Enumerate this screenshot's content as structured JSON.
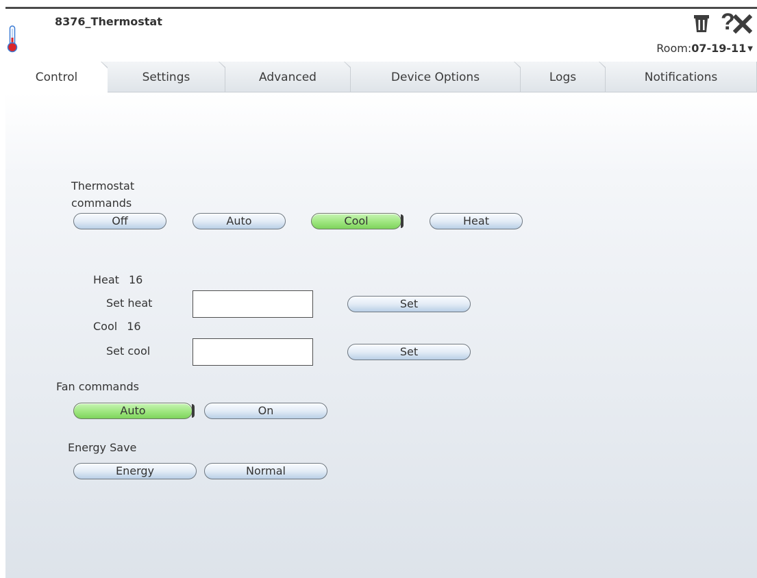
{
  "window": {
    "title": "8376_Thermostat",
    "room_label": "Room:",
    "room_value": "07-19-11",
    "device_icon": "thermometer-icon",
    "delete_icon": "trash-icon",
    "help_icon": "help-icon",
    "help_glyph": "?",
    "close_icon": "close-icon"
  },
  "tabs": [
    {
      "label": "Control",
      "active": true
    },
    {
      "label": "Settings",
      "active": false
    },
    {
      "label": "Advanced",
      "active": false
    },
    {
      "label": "Device Options",
      "active": false
    },
    {
      "label": "Logs",
      "active": false
    },
    {
      "label": "Notifications",
      "active": false
    }
  ],
  "thermostat": {
    "section_label_line1": "Thermostat",
    "section_label_line2": "commands",
    "buttons": [
      {
        "label": "Off",
        "active": false
      },
      {
        "label": "Auto",
        "active": false
      },
      {
        "label": "Cool",
        "active": true
      },
      {
        "label": "Heat",
        "active": false
      }
    ]
  },
  "setpoints": {
    "heat_label": "Heat",
    "heat_value": "16",
    "set_heat_label": "Set heat",
    "set_heat_value": "",
    "set_heat_button": "Set",
    "cool_label": "Cool",
    "cool_value": "16",
    "set_cool_label": "Set cool",
    "set_cool_value": "",
    "set_cool_button": "Set"
  },
  "fan": {
    "section_label": "Fan commands",
    "buttons": [
      {
        "label": "Auto",
        "active": true
      },
      {
        "label": "On",
        "active": false
      }
    ]
  },
  "energy": {
    "section_label": "Energy Save",
    "buttons": [
      {
        "label": "Energy",
        "active": false
      },
      {
        "label": "Normal",
        "active": false
      }
    ]
  },
  "colors": {
    "active_button": "#9ee67f",
    "button": "#d6e4f2",
    "topline": "#4a4a4a",
    "thermometer_red": "#d9262a",
    "thermometer_blue": "#3a7bd5"
  }
}
